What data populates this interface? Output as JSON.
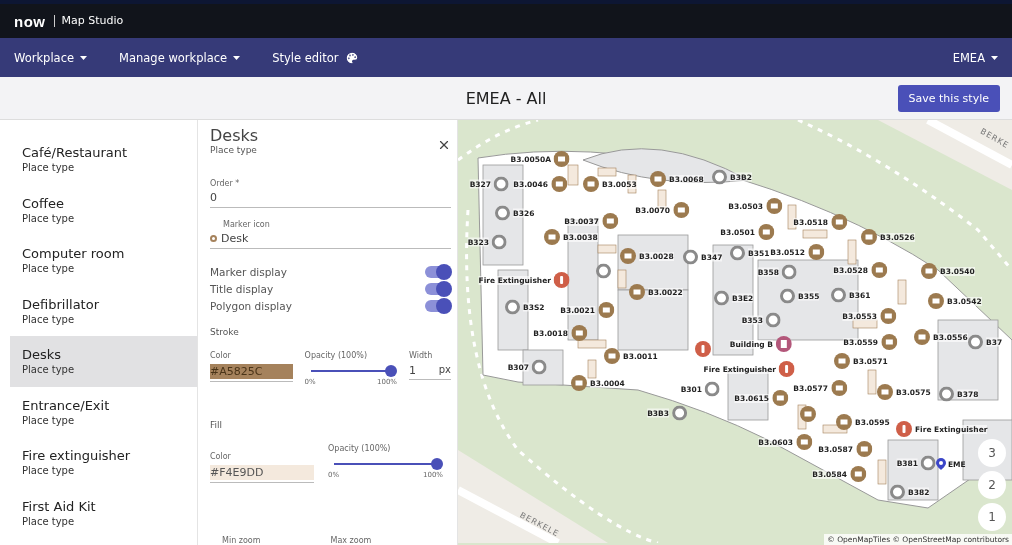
{
  "topbar": {
    "logo": "now",
    "app_name": "Map Studio"
  },
  "nav": {
    "items": [
      {
        "label": "Workplace",
        "kind": "dropdown"
      },
      {
        "label": "Manage workplace",
        "kind": "dropdown"
      },
      {
        "label": "Style editor",
        "kind": "palette"
      }
    ],
    "region": "EMEA"
  },
  "header": {
    "title": "EMEA - All",
    "save_button": "Save this style"
  },
  "place_types": [
    {
      "name": "Café/Restaurant",
      "type": "Place type",
      "selected": false
    },
    {
      "name": "Coffee",
      "type": "Place type",
      "selected": false
    },
    {
      "name": "Computer room",
      "type": "Place type",
      "selected": false
    },
    {
      "name": "Defibrillator",
      "type": "Place type",
      "selected": false
    },
    {
      "name": "Desks",
      "type": "Place type",
      "selected": true
    },
    {
      "name": "Entrance/Exit",
      "type": "Place type",
      "selected": false
    },
    {
      "name": "Fire extinguisher",
      "type": "Place type",
      "selected": false
    },
    {
      "name": "First Aid Kit",
      "type": "Place type",
      "selected": false
    }
  ],
  "editor": {
    "title": "Desks",
    "subtitle": "Place type",
    "order": {
      "label": "Order *",
      "value": "0"
    },
    "marker_icon": {
      "label": "Marker icon",
      "value": "Desk"
    },
    "toggles": [
      {
        "label": "Marker display",
        "on": true
      },
      {
        "label": "Title display",
        "on": true
      },
      {
        "label": "Polygon display",
        "on": true
      }
    ],
    "stroke": {
      "heading": "Stroke",
      "color_label": "Color",
      "color_value": "#A5825C",
      "opacity": {
        "label": "Opacity",
        "hint": "(100%)",
        "level": 1,
        "min": "0%",
        "max": "100%"
      },
      "width": {
        "label": "Width",
        "value": "1",
        "unit": "px"
      }
    },
    "fill": {
      "heading": "Fill",
      "color_label": "Color",
      "color_value": "#F4E9DD",
      "opacity": {
        "label": "Opacity",
        "hint": "(100%)",
        "level": 1,
        "min": "0%",
        "max": "100%"
      }
    },
    "zoom_labels": [
      "Min zoom",
      "Max zoom"
    ]
  },
  "map": {
    "streets": [
      "BERKE",
      "BERKELE"
    ],
    "markers": [
      {
        "kind": "desk",
        "label": "B3.0050A"
      },
      {
        "kind": "room",
        "label": "B327"
      },
      {
        "kind": "desk",
        "label": "B3.0046"
      },
      {
        "kind": "desk",
        "label": "B3.0053"
      },
      {
        "kind": "desk",
        "label": "B3.0068"
      },
      {
        "kind": "room",
        "label": "B3B2"
      },
      {
        "kind": "room",
        "label": "B326"
      },
      {
        "kind": "desk",
        "label": "B3.0070"
      },
      {
        "kind": "desk",
        "label": "B3.0503"
      },
      {
        "kind": "desk",
        "label": "B3.0037"
      },
      {
        "kind": "desk",
        "label": "B3.0518"
      },
      {
        "kind": "desk",
        "label": "B3.0526"
      },
      {
        "kind": "desk",
        "label": "B3.0501"
      },
      {
        "kind": "room",
        "label": "B323"
      },
      {
        "kind": "desk",
        "label": "B3.0038"
      },
      {
        "kind": "desk",
        "label": "B3.0028"
      },
      {
        "kind": "room",
        "label": "B347"
      },
      {
        "kind": "room",
        "label": "B351"
      },
      {
        "kind": "desk",
        "label": "B3.0512"
      },
      {
        "kind": "room",
        "label": "B358"
      },
      {
        "kind": "desk",
        "label": "B3.0528"
      },
      {
        "kind": "desk",
        "label": "B3.0540"
      },
      {
        "kind": "room"
      },
      {
        "kind": "fire",
        "label": "Fire Extinguisher"
      },
      {
        "kind": "desk",
        "label": "B3.0022"
      },
      {
        "kind": "room",
        "label": "B3E2"
      },
      {
        "kind": "room",
        "label": "B355"
      },
      {
        "kind": "room",
        "label": "B361"
      },
      {
        "kind": "desk",
        "label": "B3.0542"
      },
      {
        "kind": "room",
        "label": "B3S2"
      },
      {
        "kind": "desk",
        "label": "B3.0021"
      },
      {
        "kind": "room",
        "label": "B353"
      },
      {
        "kind": "desk",
        "label": "B3.0553"
      },
      {
        "kind": "desk",
        "label": "B3.0018"
      },
      {
        "kind": "fire"
      },
      {
        "kind": "building",
        "label": "Building B"
      },
      {
        "kind": "desk",
        "label": "B3.0559"
      },
      {
        "kind": "desk",
        "label": "B3.0556"
      },
      {
        "kind": "room",
        "label": "B37"
      },
      {
        "kind": "room",
        "label": "B307"
      },
      {
        "kind": "desk",
        "label": "B3.0011"
      },
      {
        "kind": "desk",
        "label": "B3.0571"
      },
      {
        "kind": "fire",
        "label": "Fire Extinguisher"
      },
      {
        "kind": "desk",
        "label": "B3.0004"
      },
      {
        "kind": "room",
        "label": "B301"
      },
      {
        "kind": "desk",
        "label": "B3.0577"
      },
      {
        "kind": "desk",
        "label": "B3.0575"
      },
      {
        "kind": "room",
        "label": "B378"
      },
      {
        "kind": "desk",
        "label": "B3.0615"
      },
      {
        "kind": "room",
        "label": "B3B3"
      },
      {
        "kind": "desk"
      },
      {
        "kind": "desk",
        "label": "B3.0595"
      },
      {
        "kind": "fire",
        "label": "Fire Extinguisher"
      },
      {
        "kind": "desk",
        "label": "B3.0603"
      },
      {
        "kind": "desk",
        "label": "B3.0587"
      },
      {
        "kind": "room",
        "label": "B381"
      },
      {
        "kind": "desk",
        "label": "B3.0584"
      },
      {
        "kind": "room",
        "label": "B382"
      }
    ],
    "pin_label": "EME",
    "levels": [
      "3",
      "2",
      "1"
    ],
    "attribution": "© OpenMapTiles © OpenStreetMap contributors"
  }
}
